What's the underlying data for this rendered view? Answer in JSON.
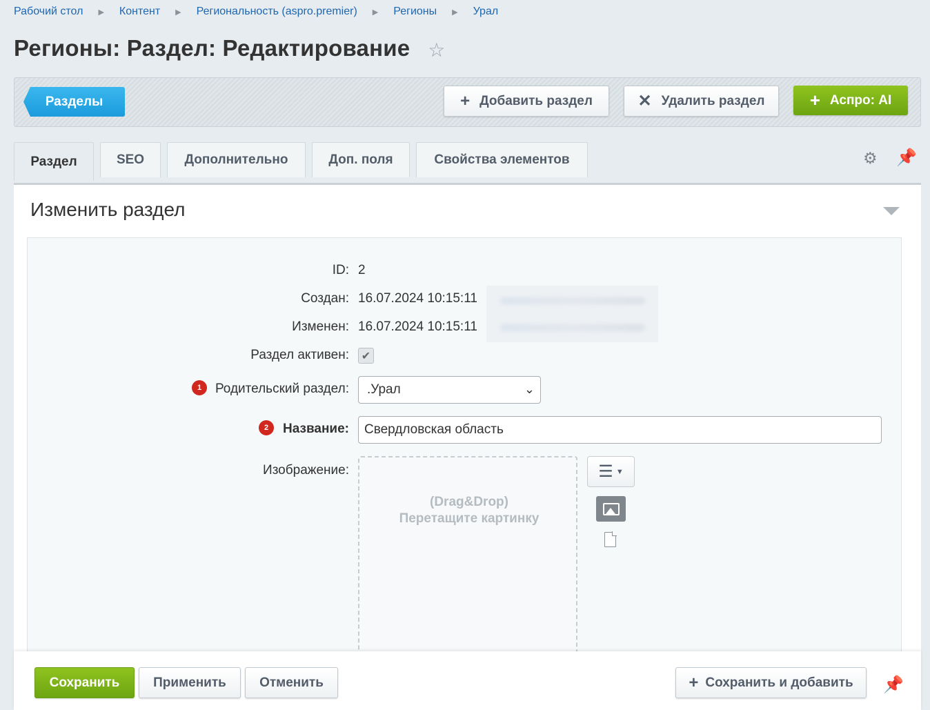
{
  "breadcrumb": [
    "Рабочий стол",
    "Контент",
    "Региональность (aspro.premier)",
    "Регионы",
    "Урал"
  ],
  "page_title": "Регионы: Раздел: Редактирование",
  "toolbar": {
    "sections_label": "Разделы",
    "add_section_label": "Добавить раздел",
    "delete_section_label": "Удалить раздел",
    "ai_label": "Аспро: AI"
  },
  "tabs": [
    "Раздел",
    "SEO",
    "Дополнительно",
    "Доп. поля",
    "Свойства элементов"
  ],
  "panel_title": "Изменить раздел",
  "form": {
    "id_label": "ID:",
    "id_value": "2",
    "created_label": "Создан:",
    "created_value": "16.07.2024 10:15:11",
    "modified_label": "Изменен:",
    "modified_value": "16.07.2024 10:15:11",
    "active_label": "Раздел активен:",
    "active_checked": true,
    "parent_badge": "1",
    "parent_label": "Родительский раздел:",
    "parent_value": ".Урал",
    "name_badge": "2",
    "name_label": "Название:",
    "name_value": "Свердловская область",
    "image_label": "Изображение:",
    "dropzone_line1": "(Drag&Drop)",
    "dropzone_line2": "Перетащите картинку"
  },
  "footer": {
    "save_label": "Сохранить",
    "apply_label": "Применить",
    "cancel_label": "Отменить",
    "save_add_label": "Сохранить и добавить"
  },
  "colors": {
    "accent_blue": "#1a9bdc",
    "accent_green": "#7bb41a",
    "badge_red": "#d0271e",
    "link": "#2067b0"
  }
}
